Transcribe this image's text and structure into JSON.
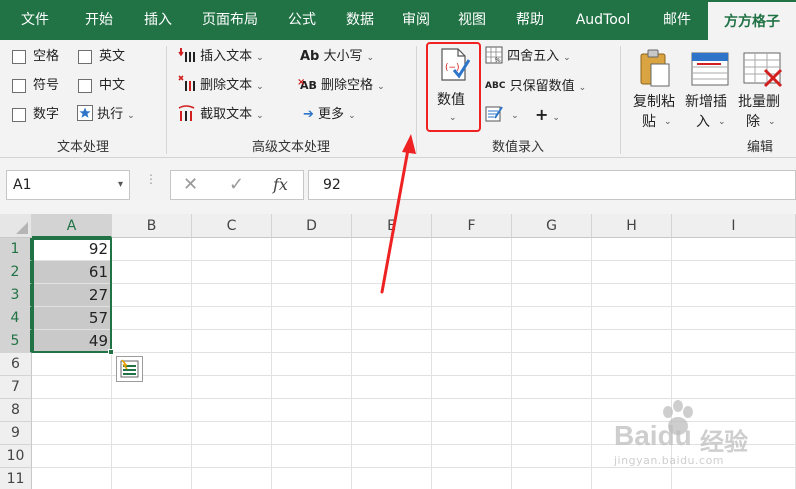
{
  "menu": {
    "tabs": [
      "文件",
      "开始",
      "插入",
      "页面布局",
      "公式",
      "数据",
      "审阅",
      "视图",
      "帮助",
      "AudTool",
      "邮件",
      "方方格子"
    ],
    "active_index": 11
  },
  "ribbon": {
    "text_processing": {
      "checkboxes": [
        "空格",
        "英文",
        "符号",
        "中文",
        "数字"
      ],
      "execute": "执行",
      "label": "文本处理"
    },
    "advanced_text": {
      "insert_text": "插入文本",
      "delete_text": "删除文本",
      "cut_text": "截取文本",
      "case": "大小写",
      "delete_spaces": "删除空格",
      "more": "更多",
      "label": "高级文本处理"
    },
    "numeric_entry": {
      "value_button": "数值",
      "round": "四舍五入",
      "keep_values": "只保留数值",
      "label": "数值录入"
    },
    "edit": {
      "copy_paste": [
        "复制粘",
        "贴"
      ],
      "add_insert": [
        "新增插",
        "入"
      ],
      "batch_delete": [
        "批量删",
        "除"
      ],
      "label": "编辑"
    }
  },
  "formula_bar": {
    "name_box": "A1",
    "fx": "fx",
    "value": "92"
  },
  "sheet": {
    "columns": [
      "A",
      "B",
      "C",
      "D",
      "E",
      "F",
      "G",
      "H",
      "I"
    ],
    "rows": [
      "1",
      "2",
      "3",
      "4",
      "5",
      "6",
      "7",
      "8",
      "9",
      "10",
      "11"
    ],
    "column_a_values": [
      "92",
      "61",
      "27",
      "57",
      "49"
    ],
    "selected_range": "A1:A5",
    "active_cell": "A1"
  },
  "watermark": {
    "brand": "Baidu",
    "brand_cn": "经验",
    "url": "jingyan.baidu.com"
  },
  "colors": {
    "excel_green": "#217346",
    "annotation_red": "#ee2222",
    "ribbon_bg": "#f3f3f3",
    "selection_fill": "#c9c9c9"
  }
}
